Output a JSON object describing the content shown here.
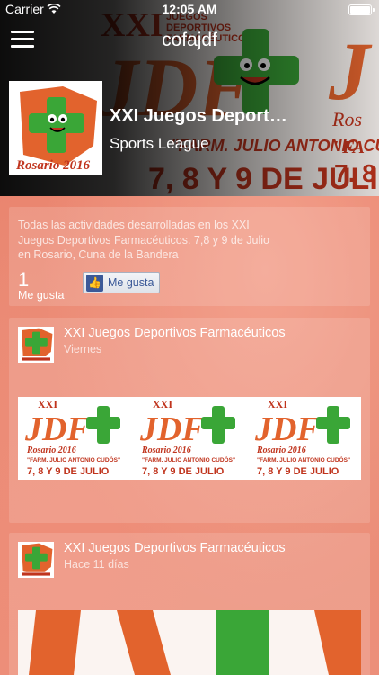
{
  "status_bar": {
    "carrier": "Carrier",
    "time": "12:05 AM"
  },
  "header": {
    "app_title": "cofajdf",
    "menu_icon": "hamburger-menu-icon",
    "page_name": "XXI Juegos Deportivos Farmacéuticos",
    "category": "Sports League"
  },
  "about": {
    "description": "Todas las actividades desarrolladas en los XXI Juegos Deportivos Farmacéuticos. 7,8 y 9 de Julio en Rosario, Cuna de la Bandera",
    "likes_count": "1",
    "likes_label": "Me gusta",
    "like_button_label": "Me gusta"
  },
  "posts": [
    {
      "author": "XXI Juegos Deportivos Farmacéuticos",
      "time": "Viernes"
    },
    {
      "author": "XXI Juegos Deportivos Farmacéuticos",
      "time": "Hace 11 días"
    }
  ],
  "logo_text": {
    "event": "JDF",
    "xxi": "XXI",
    "subtitle_lines": [
      "JUEGOS",
      "DEPORTIVOS",
      "FARMACÉUTICOS"
    ],
    "city": "Rosario 2016",
    "honoree": "\"FARM. JULIO ANTONIO CUDÓS\"",
    "dates": "7, 8 Y 9 DE JULIO"
  },
  "colors": {
    "brand_green": "#3aa637",
    "brand_orange": "#e2632d",
    "brand_red": "#c0341d",
    "background": "#e8826e",
    "facebook_blue": "#3b5998"
  }
}
